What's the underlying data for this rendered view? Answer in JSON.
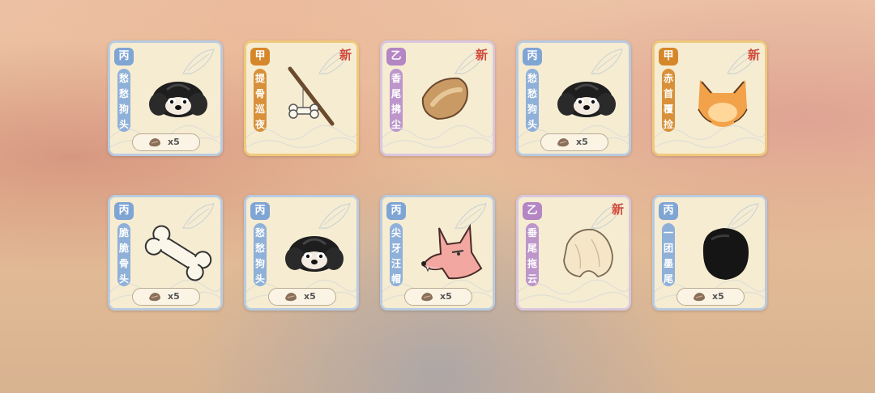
{
  "colors": {
    "bing": "#8fb0d8",
    "jia": "#d8913a",
    "yi": "#bd96cb",
    "new_tag": "#d24a3a"
  },
  "cards": [
    {
      "tier": "丙",
      "tier_key": "bing",
      "name": "愁愁狗头",
      "is_new": false,
      "new_label": "",
      "cost": "x5",
      "art_icon": "shihtzu-head-icon"
    },
    {
      "tier": "甲",
      "tier_key": "jia",
      "name": "提骨巡夜",
      "is_new": true,
      "new_label": "新",
      "cost": "",
      "art_icon": "bone-on-stick-icon"
    },
    {
      "tier": "乙",
      "tier_key": "yi",
      "name": "香尾拂尘",
      "is_new": true,
      "new_label": "新",
      "cost": "",
      "art_icon": "brown-tail-icon"
    },
    {
      "tier": "丙",
      "tier_key": "bing",
      "name": "愁愁狗头",
      "is_new": false,
      "new_label": "",
      "cost": "x5",
      "art_icon": "shihtzu-head-icon"
    },
    {
      "tier": "甲",
      "tier_key": "jia",
      "name": "赤首覆捡",
      "is_new": true,
      "new_label": "新",
      "cost": "",
      "art_icon": "fox-head-icon"
    },
    {
      "tier": "丙",
      "tier_key": "bing",
      "name": "脆脆骨头",
      "is_new": false,
      "new_label": "",
      "cost": "x5",
      "art_icon": "bone-icon"
    },
    {
      "tier": "丙",
      "tier_key": "bing",
      "name": "愁愁狗头",
      "is_new": false,
      "new_label": "",
      "cost": "x5",
      "art_icon": "shihtzu-head-icon"
    },
    {
      "tier": "丙",
      "tier_key": "bing",
      "name": "尖牙汪帽",
      "is_new": false,
      "new_label": "",
      "cost": "x5",
      "art_icon": "wolf-hat-icon"
    },
    {
      "tier": "乙",
      "tier_key": "yi",
      "name": "垂尾拖云",
      "is_new": true,
      "new_label": "新",
      "cost": "",
      "art_icon": "cream-tail-icon"
    },
    {
      "tier": "丙",
      "tier_key": "bing",
      "name": "一团墨尾",
      "is_new": false,
      "new_label": "",
      "cost": "x5",
      "art_icon": "black-tail-icon"
    }
  ]
}
